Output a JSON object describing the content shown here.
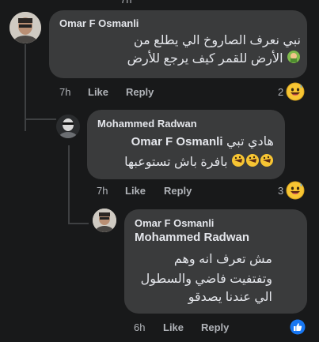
{
  "comments": [
    {
      "author": "Omar F Osmanli",
      "line1": "نبي نعرف الصاروخ الي يطلع من",
      "line2": "الأرض للقمر كيف يرجع للأرض",
      "time": "7h",
      "like": "Like",
      "reply": "Reply",
      "reaction_count": "2",
      "reaction_icon": "grinning-sweat-face-icon"
    },
    {
      "author": "Mohammed Radwan",
      "mention": "Omar F Osmanli",
      "line1": "هادي تبي",
      "line2": "بافرة باش تستوعبها",
      "time": "7h",
      "like": "Like",
      "reply": "Reply",
      "reaction_count": "3",
      "reaction_icon": "grinning-sweat-face-icon"
    },
    {
      "author": "Omar F Osmanli",
      "mention": "Mohammed Radwan",
      "line1": "مش تعرف انه وهم",
      "line2": "وتفتفيت فاضي والسطول",
      "line3": "الي عندنا يصدقو",
      "time": "6h",
      "like": "Like",
      "reply": "Reply",
      "reaction_icon": "like-thumb-icon"
    }
  ],
  "colors": {
    "background": "#18191a",
    "bubble": "#3a3b3c",
    "text": "#e4e6eb",
    "secondary": "#b0b3b8",
    "like_blue": "#1877f2"
  }
}
